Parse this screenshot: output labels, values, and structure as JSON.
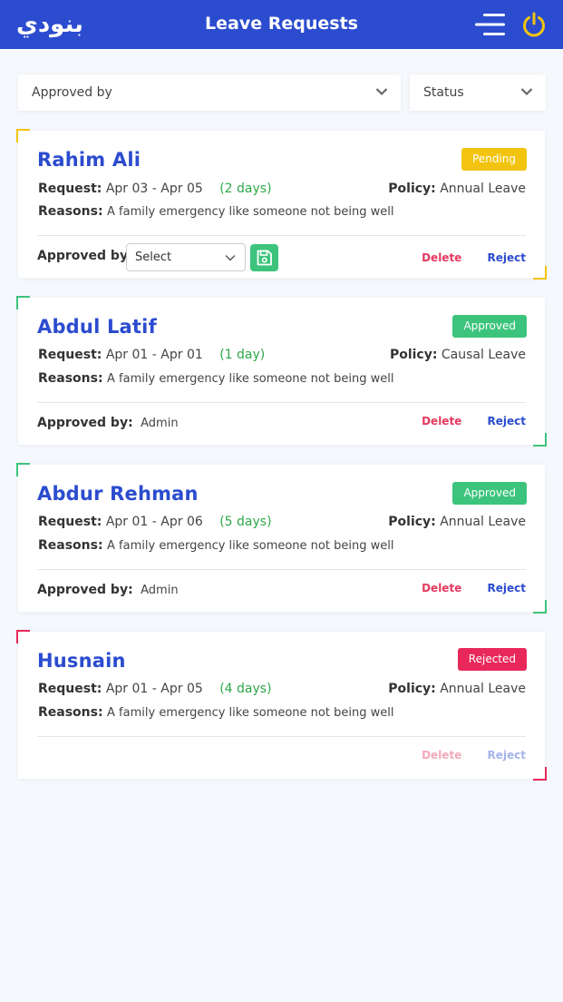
{
  "header": {
    "logo_text": "بنودي",
    "title": "Leave Requests",
    "menu_icon": "menu-lines-icon",
    "power_icon": "power-icon"
  },
  "filters": {
    "approved_by": "Approved by",
    "status": "Status"
  },
  "labels": {
    "request": "Request:",
    "reasons": "Reasons:",
    "policy": "Policy:",
    "approved_by": "Approved by:",
    "delete": "Delete",
    "reject": "Reject",
    "select_placeholder": "Select"
  },
  "colors": {
    "primary": "#2b4ccf",
    "pending": "#f2c40f",
    "approved": "#3cc47c",
    "rejected": "#e8285a",
    "days": "#2ea84a"
  },
  "requests": [
    {
      "name": "Rahim Ali",
      "status": "Pending",
      "dates": "Apr 03 - Apr 05",
      "days": "(2 days)",
      "policy": "Annual Leave",
      "reason": "A family emergency like someone not being well",
      "approver": ""
    },
    {
      "name": "Abdul Latif",
      "status": "Approved",
      "dates": "Apr 01 - Apr 01",
      "days": "(1 day)",
      "policy": "Causal Leave",
      "reason": "A family emergency like someone not being well",
      "approver": "Admin"
    },
    {
      "name": "Abdur Rehman",
      "status": "Approved",
      "dates": "Apr 01 - Apr 06",
      "days": "(5 days)",
      "policy": "Annual Leave",
      "reason": "A family emergency like someone not being well",
      "approver": "Admin"
    },
    {
      "name": "Husnain",
      "status": "Rejected",
      "dates": "Apr 01 - Apr 05",
      "days": "(4 days)",
      "policy": "Annual Leave",
      "reason": "A family emergency like someone not being well",
      "approver": ""
    }
  ]
}
